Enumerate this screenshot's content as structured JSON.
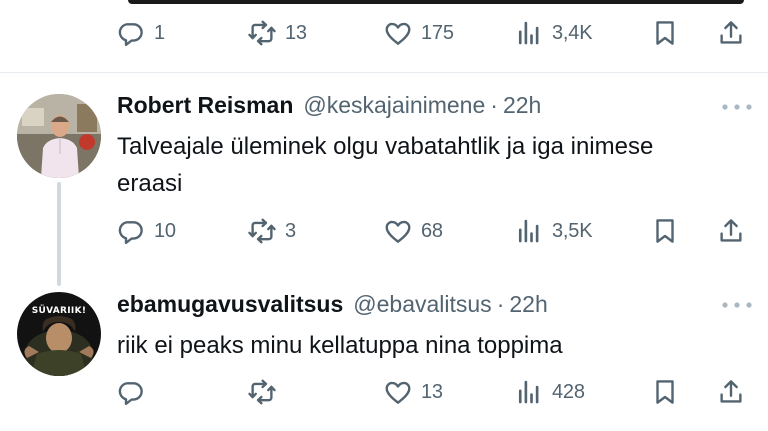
{
  "top_actions": {
    "replies": "1",
    "reposts": "13",
    "likes": "175",
    "views": "3,4K"
  },
  "tweets": [
    {
      "name": "Robert Reisman",
      "handle": "@keskajainimene",
      "separator": "·",
      "time": "22h",
      "text": "Talveajale üleminek olgu vabatahtlik ja iga inimese eraasi",
      "actions": {
        "replies": "10",
        "reposts": "3",
        "likes": "68",
        "views": "3,5K"
      }
    },
    {
      "name": "ebamugavusvalitsus",
      "handle": "@ebavalitsus",
      "separator": "·",
      "time": "22h",
      "avatar_text": "SÜVARIIK!",
      "text": "riik ei peaks minu kellatuppa nina toppima",
      "actions": {
        "replies": "",
        "reposts": "",
        "likes": "13",
        "views": "428"
      }
    }
  ],
  "colors": {
    "text": "#0f1419",
    "secondary": "#536471",
    "divider": "#e6ecf0",
    "thread": "#cfd9de"
  },
  "icons": [
    "reply-icon",
    "repost-icon",
    "like-icon",
    "views-icon",
    "bookmark-icon",
    "share-icon",
    "more-icon"
  ]
}
